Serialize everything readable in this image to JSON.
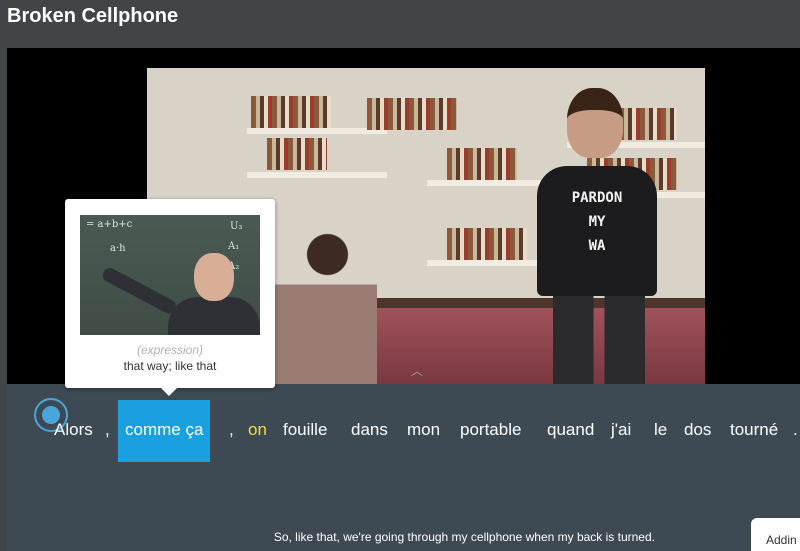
{
  "header": {
    "title": "Broken Cellphone"
  },
  "video": {
    "shirt_text": [
      "PARDON",
      "MY",
      "WA"
    ]
  },
  "tooltip": {
    "chalk_lines": [
      "= a+b+c",
      "a·h",
      "U₃",
      "A₁",
      "A₂"
    ],
    "part_of_speech": "(expression)",
    "definition": "that way; like that"
  },
  "subtitle": {
    "words": [
      "Alors",
      ",",
      "comme ça",
      ",",
      "on",
      "fouille",
      "dans",
      "mon",
      "portable",
      "quand",
      "j'ai",
      "le",
      "dos",
      "tourné",
      "."
    ],
    "selected_word": "comme ça",
    "highlight_color": "#1aa0e0",
    "known_word_color": "#f1dd38",
    "translation": "So, like that, we're going through my cellphone when my back is turned."
  },
  "side_panel": {
    "label": "Addin"
  },
  "icons": {
    "record": "record-icon",
    "collapse": "chevron-up-icon"
  }
}
